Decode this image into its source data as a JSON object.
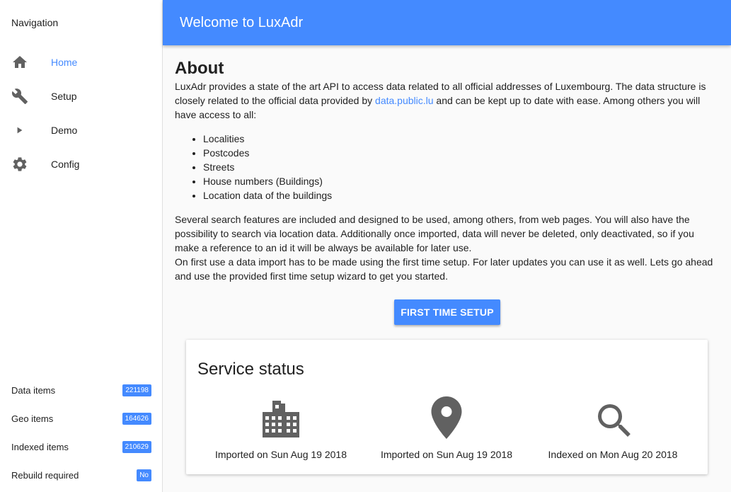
{
  "sidebar": {
    "title": "Navigation",
    "items": [
      {
        "label": "Home",
        "icon": "home-icon",
        "active": true
      },
      {
        "label": "Setup",
        "icon": "wrench-icon"
      },
      {
        "label": "Demo",
        "icon": "play-icon"
      },
      {
        "label": "Config",
        "icon": "gear-icon"
      }
    ],
    "stats": [
      {
        "label": "Data items",
        "value": "221198"
      },
      {
        "label": "Geo items",
        "value": "164626"
      },
      {
        "label": "Indexed items",
        "value": "210629"
      },
      {
        "label": "Rebuild required",
        "value": "No"
      }
    ]
  },
  "header": {
    "title": "Welcome to LuxAdr"
  },
  "about": {
    "title": "About",
    "intro_before_link": "LuxAdr provides a state of the art API to access data related to all official addresses of Luxembourg. The data structure is closely related to the official data provided by ",
    "link_text": "data.public.lu",
    "intro_after_link": " and can be kept up to date with ease. Among others you will have access to all:",
    "features": [
      "Localities",
      "Postcodes",
      "Streets",
      "House numbers (Buildings)",
      "Location data of the buildings"
    ],
    "para2": "Several search features are included and designed to be used, among others, from web pages. You will also have the possibility to search via location data. Additionally once imported, data will never be deleted, only deactivated, so if you make a reference to an id it will be always be available for later use.",
    "para3": "On first use a data import has to be made using the first time setup. For later updates you can use it as well. Lets go ahead and use the provided first time setup wizard to get you started.",
    "button_label": "FIRST TIME SETUP"
  },
  "service_status": {
    "title": "Service status",
    "items": [
      {
        "icon": "building-icon",
        "text": "Imported on Sun Aug 19 2018"
      },
      {
        "icon": "location-pin-icon",
        "text": "Imported on Sun Aug 19 2018"
      },
      {
        "icon": "search-icon",
        "text": "Indexed on Mon Aug 20 2018"
      }
    ]
  },
  "colors": {
    "accent": "#448aff",
    "icon": "#616161"
  }
}
